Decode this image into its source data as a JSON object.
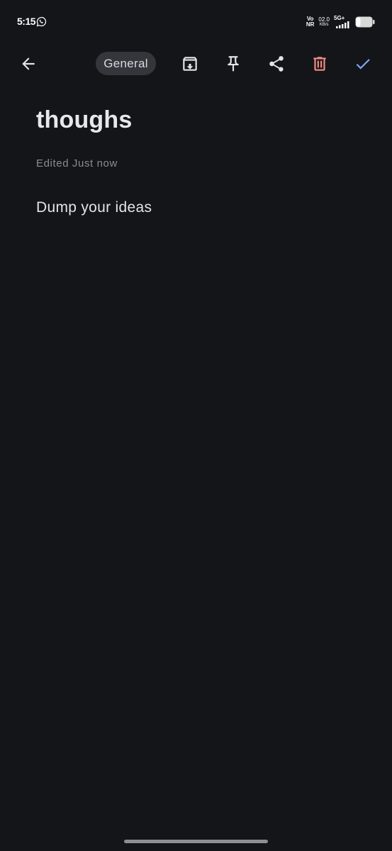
{
  "status_bar": {
    "time": "5:15",
    "volte_top": "Vo",
    "volte_bottom": "NR",
    "speed_value": "02.0",
    "speed_unit": "KB/s",
    "network_type": "5G+",
    "icons": [
      "whatsapp-icon",
      "signal-icon",
      "battery-icon"
    ]
  },
  "toolbar": {
    "category": "General",
    "icons": [
      "back-arrow-icon",
      "archive-icon",
      "pin-icon",
      "share-icon",
      "delete-icon",
      "check-icon"
    ]
  },
  "note": {
    "title": "thoughs",
    "edited": "Edited Just now",
    "body_placeholder": "Dump your ideas"
  },
  "colors": {
    "background": "#141519",
    "chip_background": "#34363c",
    "accent": "#7ea6f5",
    "delete": "#f28b82"
  }
}
